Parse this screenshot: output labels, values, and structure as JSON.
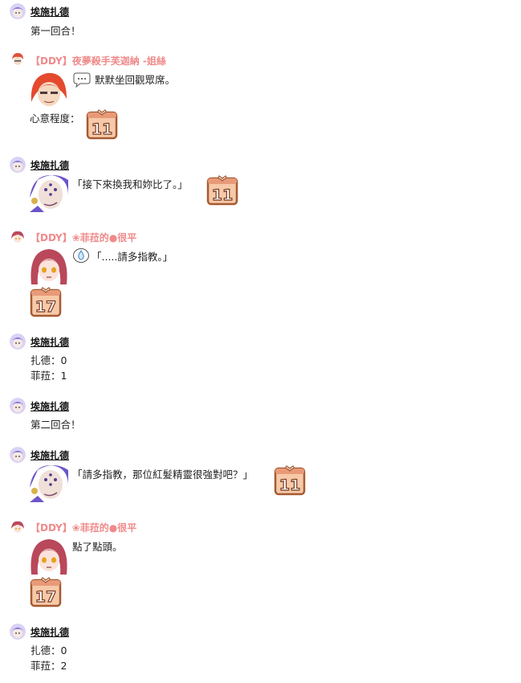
{
  "messages": [
    {
      "speaker": "埃施扎德",
      "lines": [
        "第一回合！"
      ]
    },
    {
      "speaker": "【DDY】夜夢殺手芙迦納 -姐絲",
      "lines": [
        "默默坐回觀眾席。",
        "心意程度："
      ],
      "dice": "11",
      "bubble": "…"
    },
    {
      "speaker": "埃施扎德",
      "lines": [
        "「接下來換我和妳比了。」"
      ],
      "dice": "11"
    },
    {
      "speaker": "【DDY】❀菲菈的●很平",
      "lines": [
        "「.....請多指教。」"
      ],
      "dice": "17"
    },
    {
      "speaker": "埃施扎德",
      "lines": [
        "扎德：0",
        "菲菈：1"
      ]
    },
    {
      "speaker": "埃施扎德",
      "lines": [
        "第二回合！"
      ]
    },
    {
      "speaker": "埃施扎德",
      "lines": [
        "「請多指教，那位紅髮精靈很強對吧？」"
      ],
      "dice": "11"
    },
    {
      "speaker": "【DDY】❀菲菈的●很平",
      "lines": [
        "點了點頭。"
      ],
      "dice": "17"
    },
    {
      "speaker": "埃施扎德",
      "lines": [
        "扎德：0",
        "菲菈：2"
      ]
    }
  ],
  "icons": {
    "purple_avatar": "purple-avatar-icon",
    "red_avatar": "red-avatar-icon",
    "pink_avatar": "pink-avatar-icon",
    "dice": "dice-icon",
    "bubble": "speech-bubble-icon"
  }
}
